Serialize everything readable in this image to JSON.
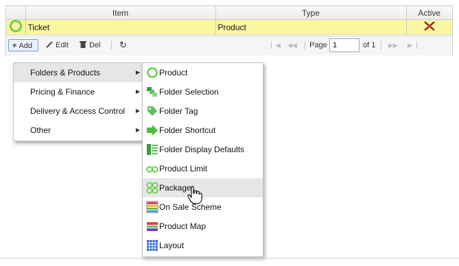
{
  "grid": {
    "columns": [
      "Item",
      "Type",
      "Active"
    ],
    "rows": [
      {
        "item": "Ticket",
        "type": "Product"
      }
    ]
  },
  "toolbar": {
    "add_label": "Add",
    "edit_label": "Edit",
    "del_label": "Del",
    "page_label": "Page",
    "page_value": "1",
    "of_label": "of 1"
  },
  "menu_main": {
    "items": [
      {
        "label": "Folders & Products",
        "active": true
      },
      {
        "label": "Pricing & Finance"
      },
      {
        "label": "Delivery & Access Control"
      },
      {
        "label": "Other"
      }
    ]
  },
  "menu_sub": {
    "items": [
      {
        "label": "Product",
        "icon": "ring-icon"
      },
      {
        "label": "Folder Selection",
        "icon": "folder-selection-icon"
      },
      {
        "label": "Folder Tag",
        "icon": "tag-icon"
      },
      {
        "label": "Folder Shortcut",
        "icon": "arrow-right-icon"
      },
      {
        "label": "Folder Display Defaults",
        "icon": "display-defaults-icon"
      },
      {
        "label": "Product Limit",
        "icon": "double-ring-icon"
      },
      {
        "label": "Package",
        "icon": "quad-ring-icon",
        "hover": true
      },
      {
        "label": "On Sale Scheme",
        "icon": "scheme-icon"
      },
      {
        "label": "Product Map",
        "icon": "product-map-icon"
      },
      {
        "label": "Layout",
        "icon": "layout-grid-icon"
      }
    ]
  },
  "colors": {
    "row_highlight": "#fbf6a0",
    "icon_green": "#6ad04a",
    "menu_hover": "#e6e6e6"
  }
}
